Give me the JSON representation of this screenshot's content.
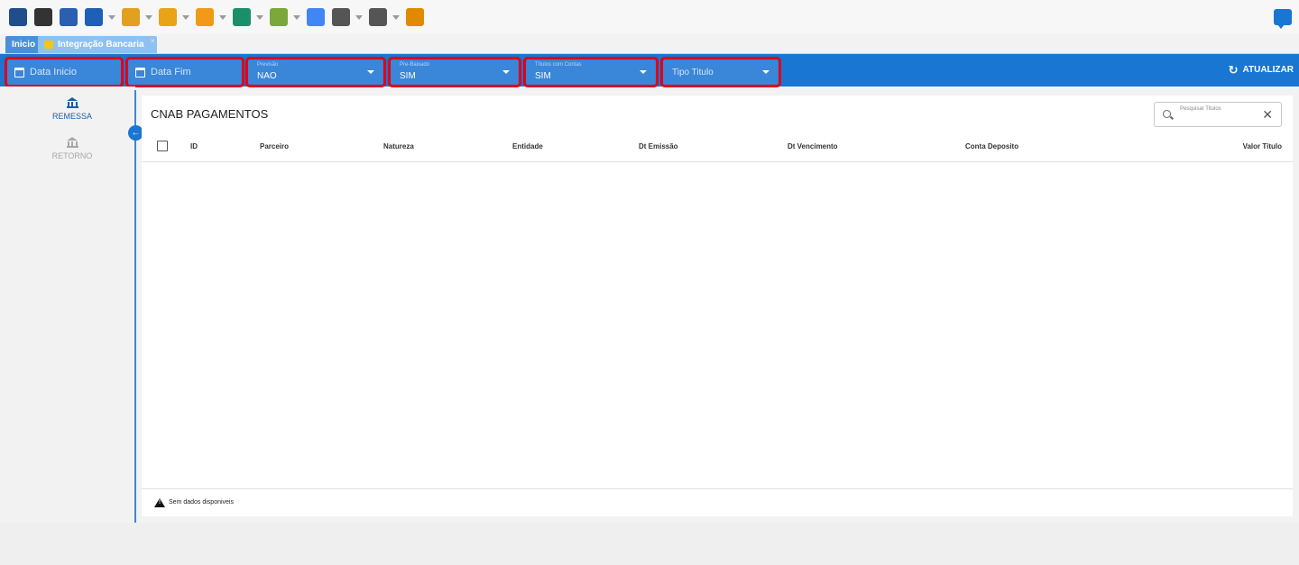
{
  "toolbar": {
    "icons": [
      {
        "name": "globe-icon",
        "color": "#1f4e8a",
        "dropdown": false
      },
      {
        "name": "barcode-icon",
        "color": "#333333",
        "dropdown": false
      },
      {
        "name": "bi-report-icon",
        "color": "#2b5fb0",
        "dropdown": false
      },
      {
        "name": "settings-icon",
        "color": "#1f5fb8",
        "dropdown": true
      },
      {
        "name": "people-icon",
        "color": "#e0a020",
        "dropdown": true
      },
      {
        "name": "bar-chart-icon",
        "color": "#e8a317",
        "dropdown": true
      },
      {
        "name": "box-icon",
        "color": "#f09a18",
        "dropdown": true
      },
      {
        "name": "cart-icon",
        "color": "#1b8f6a",
        "dropdown": true
      },
      {
        "name": "handshake-icon",
        "color": "#7aa83a",
        "dropdown": true
      },
      {
        "name": "google-icon",
        "color": "#4285f4",
        "dropdown": false
      },
      {
        "name": "mail-tray-icon",
        "color": "#555555",
        "dropdown": true
      },
      {
        "name": "mail-tray-icon",
        "color": "#555555",
        "dropdown": true
      },
      {
        "name": "bank-icon",
        "color": "#e08a00",
        "dropdown": false
      }
    ]
  },
  "tabs": [
    {
      "label": "Inicio"
    },
    {
      "label": "Integração Bancaria"
    }
  ],
  "filters": {
    "data_inicio": {
      "placeholder": "Data Inicio"
    },
    "data_fim": {
      "placeholder": "Data Fim"
    },
    "previsao": {
      "label": "Previsão",
      "value": "NAO"
    },
    "pre_baixado": {
      "label": "Pre-Baixado",
      "value": "SIM"
    },
    "titulos_com_contas": {
      "label": "Títulos com Contas",
      "value": "SIM"
    },
    "tipo_titulo": {
      "placeholder": "Tipo Titulo"
    },
    "refresh_label": "ATUALIZAR"
  },
  "sidebar": {
    "items": [
      {
        "label": "REMESSA",
        "active": true
      },
      {
        "label": "RETORNO",
        "active": false
      }
    ]
  },
  "main": {
    "title": "CNAB PAGAMENTOS",
    "search_placeholder": "Pesquisar Titulos",
    "columns": [
      "ID",
      "Parceiro",
      "Natureza",
      "Entidade",
      "Dt Emissão",
      "Dt Vencimento",
      "Conta Deposito",
      "Valor Titulo"
    ],
    "empty_message": "Sem dados disponiveis"
  },
  "colors": {
    "primary": "#1976d2",
    "highlight_outline": "#e0001a"
  }
}
